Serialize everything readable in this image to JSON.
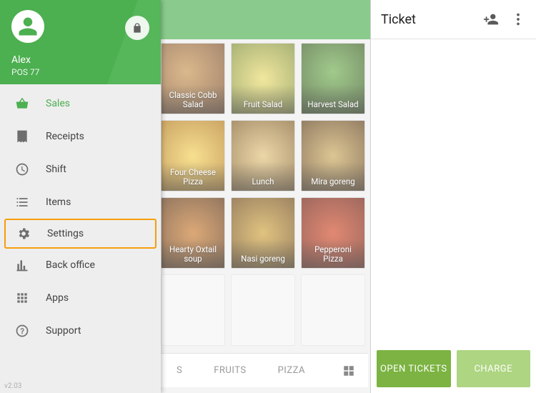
{
  "colors": {
    "primary": "#4caf50",
    "highlight": "#f59e0b"
  },
  "user": {
    "name": "Alex",
    "pos": "POS 77"
  },
  "version": "v2.03",
  "ticket": {
    "title": "Ticket",
    "open_label": "OPEN TICKETS",
    "charge_label": "CHARGE"
  },
  "sidebar": {
    "items": [
      {
        "icon": "basket-icon",
        "label": "Sales",
        "active": true
      },
      {
        "icon": "receipt-icon",
        "label": "Receipts"
      },
      {
        "icon": "clock-icon",
        "label": "Shift"
      },
      {
        "icon": "list-icon",
        "label": "Items"
      },
      {
        "icon": "gear-icon",
        "label": "Settings",
        "highlight": true
      },
      {
        "icon": "chart-icon",
        "label": "Back office"
      },
      {
        "icon": "apps-icon",
        "label": "Apps"
      },
      {
        "icon": "help-icon",
        "label": "Support"
      }
    ]
  },
  "categories": {
    "tabs": [
      "S",
      "FRUITS",
      "PIZZA"
    ]
  },
  "grid": {
    "items": [
      {
        "label": "Classic Cobb Salad"
      },
      {
        "label": "Fruit Salad"
      },
      {
        "label": "Harvest Salad"
      },
      {
        "label": "Four Cheese Pizza"
      },
      {
        "label": "Lunch"
      },
      {
        "label": "Mira goreng"
      },
      {
        "label": "Hearty Oxtail soup"
      },
      {
        "label": "Nasi goreng"
      },
      {
        "label": "Pepperoni Pizza"
      }
    ]
  }
}
